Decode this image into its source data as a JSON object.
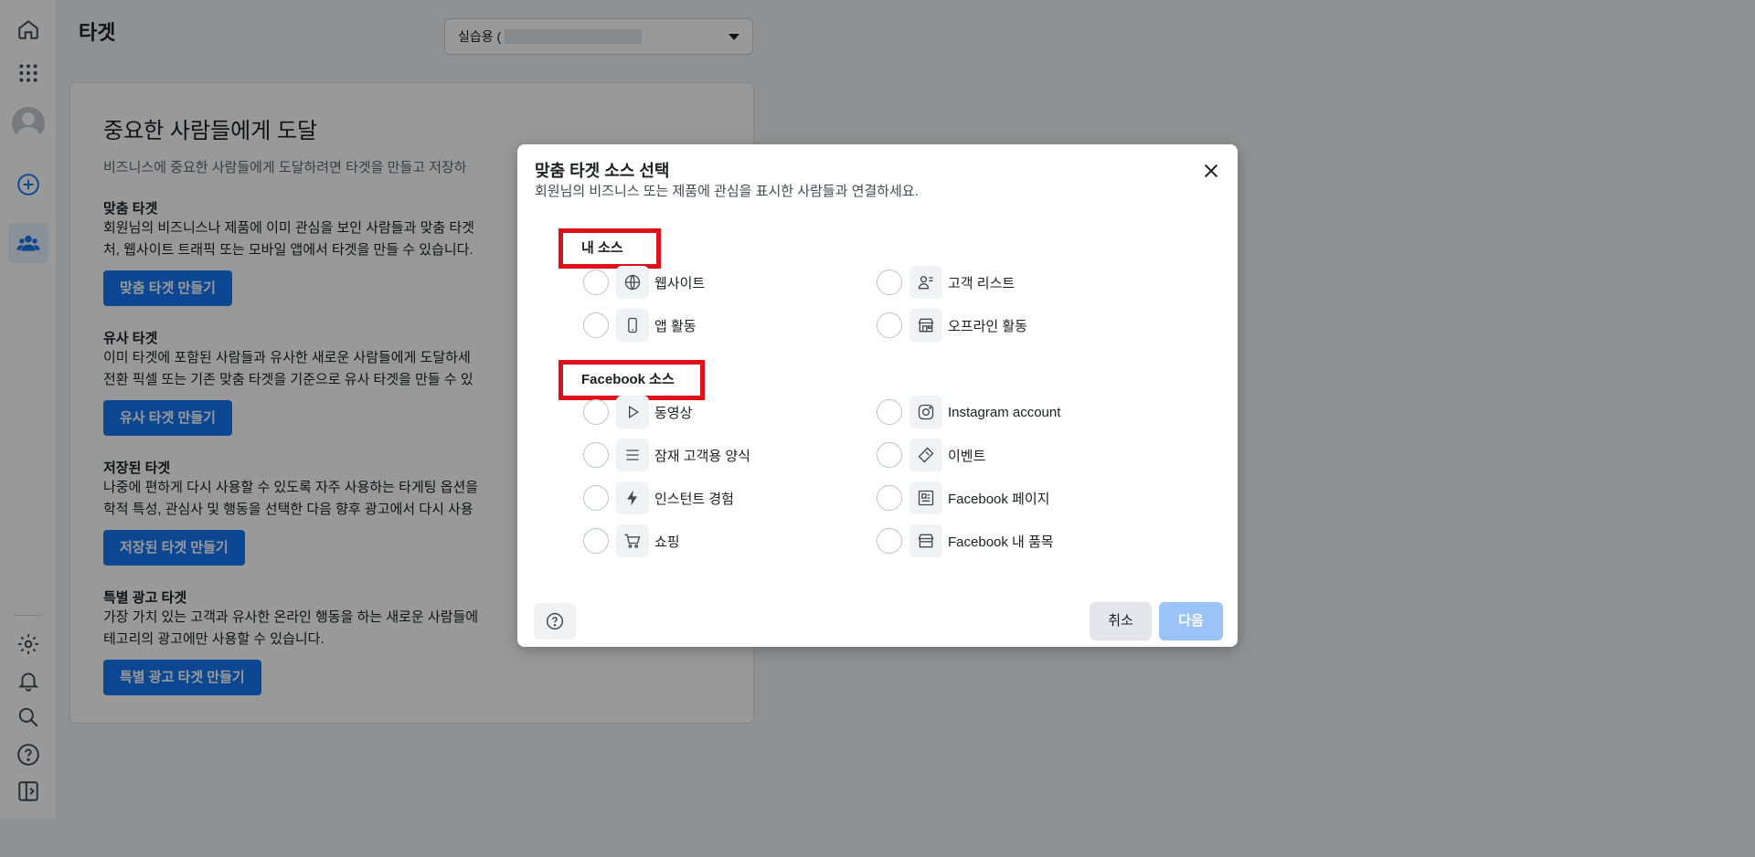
{
  "page": {
    "title": "타겟",
    "account_select": {
      "value": "실습용 ("
    }
  },
  "card": {
    "heading": "중요한 사람들에게 도달",
    "intro": "비즈니스에 중요한 사람들에게 도달하려면 타겟을 만들고 저장하",
    "sections": [
      {
        "title": "맞춤 타겟",
        "lines": [
          "회원님의 비즈니스나 제품에 이미 관심을 보인 사람들과 맞춤 타겟",
          "처, 웹사이트 트래픽 또는 모바일 앱에서 타겟을 만들 수 있습니다."
        ],
        "button": "맞춤 타겟 만들기"
      },
      {
        "title": "유사 타겟",
        "lines": [
          "이미 타겟에 포함된 사람들과 유사한 새로운 사람들에게 도달하세",
          "전환 픽셀 또는 기존 맞춤 타겟을 기준으로 유사 타겟을 만들 수 있"
        ],
        "button": "유사 타겟 만들기"
      },
      {
        "title": "저장된 타겟",
        "lines": [
          "나중에 편하게 다시 사용할 수 있도록 자주 사용하는 타게팅 옵션을",
          "학적 특성, 관심사 및 행동을 선택한 다음 향후 광고에서 다시 사용"
        ],
        "button": "저장된 타겟 만들기"
      },
      {
        "title": "특별 광고 타겟",
        "lines": [
          "가장 가치 있는 고객과 유사한 온라인 행동을 하는 새로운 사람들에",
          "테고리의 광고에만 사용할 수 있습니다."
        ],
        "button": "특별 광고 타겟 만들기"
      }
    ]
  },
  "dialog": {
    "title": "맞춤 타겟 소스 선택",
    "subtitle": "회원님의 비즈니스 또는 제품에 관심을 표시한 사람들과 연결하세요.",
    "my_sources": {
      "label": "내 소스",
      "options": [
        {
          "label": "웹사이트",
          "icon": "globe-icon"
        },
        {
          "label": "고객 리스트",
          "icon": "customer-list-icon"
        },
        {
          "label": "앱 활동",
          "icon": "mobile-app-icon"
        },
        {
          "label": "오프라인 활동",
          "icon": "store-icon"
        }
      ]
    },
    "facebook_sources": {
      "label": "Facebook 소스",
      "options": [
        {
          "label": "동영상",
          "icon": "play-icon"
        },
        {
          "label": "Instagram account",
          "icon": "instagram-icon"
        },
        {
          "label": "잠재 고객용 양식",
          "icon": "form-lines-icon"
        },
        {
          "label": "이벤트",
          "icon": "ticket-icon"
        },
        {
          "label": "인스턴트 경험",
          "icon": "lightning-icon"
        },
        {
          "label": "Facebook 페이지",
          "icon": "facebook-page-icon"
        },
        {
          "label": "쇼핑",
          "icon": "shopping-cart-icon"
        },
        {
          "label": "Facebook 내 품목",
          "icon": "shop-icon"
        }
      ]
    },
    "cancel_label": "취소",
    "next_label": "다음"
  }
}
